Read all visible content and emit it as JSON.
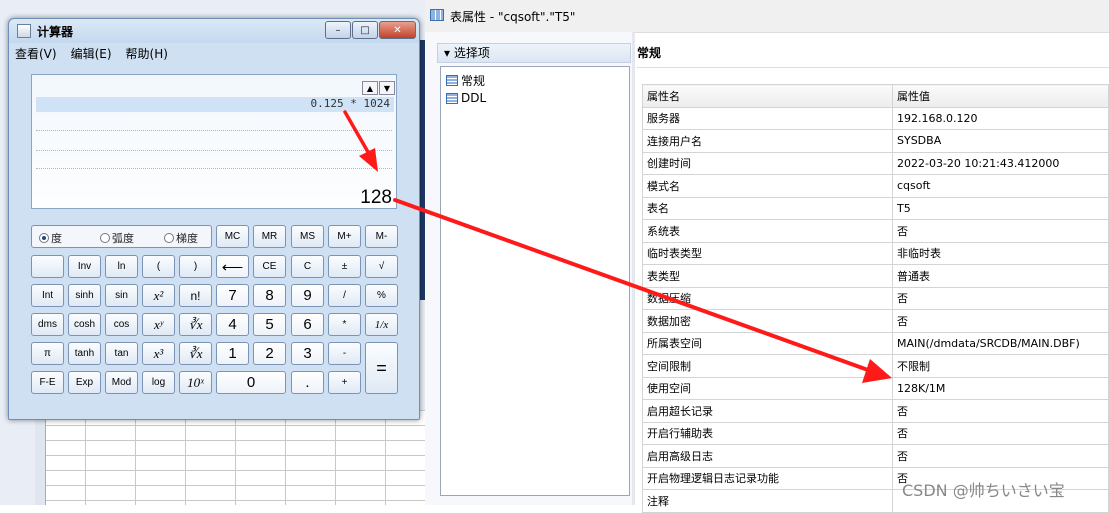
{
  "calculator": {
    "title": "计算器",
    "window_buttons": {
      "minimize": "–",
      "maximize": "□",
      "close": "✕"
    },
    "menu": [
      "查看(V)",
      "编辑(E)",
      "帮助(H)"
    ],
    "display": {
      "expression": "0.125 * 1024",
      "result": "128"
    },
    "angle_modes": [
      {
        "label": "度",
        "selected": true
      },
      {
        "label": "弧度",
        "selected": false
      },
      {
        "label": "梯度",
        "selected": false
      }
    ],
    "memory_keys": [
      "MC",
      "MR",
      "MS",
      "M+",
      "M-"
    ],
    "keys": {
      "row2": [
        "",
        "Inv",
        "ln",
        "(",
        ")",
        "⟵",
        "CE",
        "C",
        "±",
        "√"
      ],
      "row3": [
        "Int",
        "sinh",
        "sin",
        "x²",
        "n!",
        "7",
        "8",
        "9",
        "/",
        "%"
      ],
      "row4": [
        "dms",
        "cosh",
        "cos",
        "xʸ",
        "∛x",
        "4",
        "5",
        "6",
        "*",
        "1/x"
      ],
      "row5": [
        "π",
        "tanh",
        "tan",
        "x³",
        "∛x",
        "1",
        "2",
        "3",
        "-",
        "="
      ],
      "row6": [
        "F-E",
        "Exp",
        "Mod",
        "log",
        "10ˣ",
        "0",
        ".",
        "+"
      ]
    }
  },
  "properties_window": {
    "title": "表属性 - \"cqsoft\".\"T5\"",
    "section_label": "选择项",
    "tree_items": [
      "常规",
      "DDL"
    ],
    "main_title": "常规",
    "table_headers": [
      "属性名",
      "属性值"
    ],
    "rows": [
      [
        "服务器",
        "192.168.0.120"
      ],
      [
        "连接用户名",
        "SYSDBA"
      ],
      [
        "创建时间",
        "2022-03-20 10:21:43.412000"
      ],
      [
        "模式名",
        "cqsoft"
      ],
      [
        "表名",
        "T5"
      ],
      [
        "系统表",
        "否"
      ],
      [
        "临时表类型",
        "非临时表"
      ],
      [
        "表类型",
        "普通表"
      ],
      [
        "数据压缩",
        "否"
      ],
      [
        "数据加密",
        "否"
      ],
      [
        "所属表空间",
        "MAIN(/dmdata/SRCDB/MAIN.DBF)"
      ],
      [
        "空间限制",
        "不限制"
      ],
      [
        "使用空间",
        "128K/1M"
      ],
      [
        "启用超长记录",
        "否"
      ],
      [
        "开启行辅助表",
        "否"
      ],
      [
        "启用高级日志",
        "否"
      ],
      [
        "开启物理逻辑日志记录功能",
        "否"
      ],
      [
        "注释",
        ""
      ]
    ]
  },
  "watermark": "CSDN @帅ちいさい宝",
  "colors": {
    "arrow": "#ff1a1a",
    "selection": "#cfe2f6",
    "window_frame": "#cfe0f3"
  }
}
